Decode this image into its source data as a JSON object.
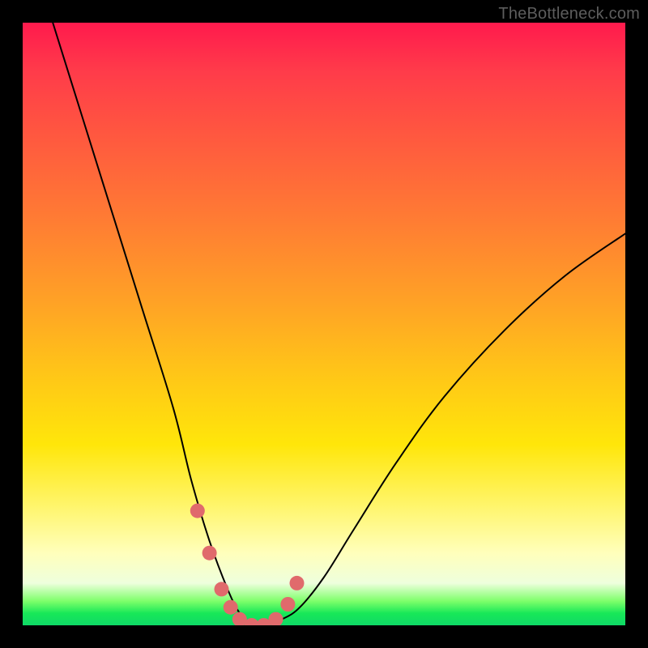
{
  "watermark": "TheBottleneck.com",
  "chart_data": {
    "type": "line",
    "title": "",
    "xlabel": "",
    "ylabel": "",
    "xlim": [
      0,
      100
    ],
    "ylim": [
      0,
      100
    ],
    "series": [
      {
        "name": "bottleneck-curve",
        "x": [
          5,
          10,
          15,
          20,
          25,
          28,
          31,
          34,
          36,
          38,
          40,
          43,
          46,
          50,
          55,
          62,
          70,
          80,
          90,
          100
        ],
        "values": [
          100,
          84,
          68,
          52,
          36,
          24,
          14,
          6,
          2,
          0,
          0,
          1,
          3,
          8,
          16,
          27,
          38,
          49,
          58,
          65
        ]
      }
    ],
    "highlighted_points": {
      "x": [
        29,
        31,
        33,
        34.5,
        36,
        38,
        40,
        42,
        44,
        45.5
      ],
      "values": [
        19,
        12,
        6,
        3,
        1,
        0,
        0,
        1,
        3.5,
        7
      ]
    }
  }
}
